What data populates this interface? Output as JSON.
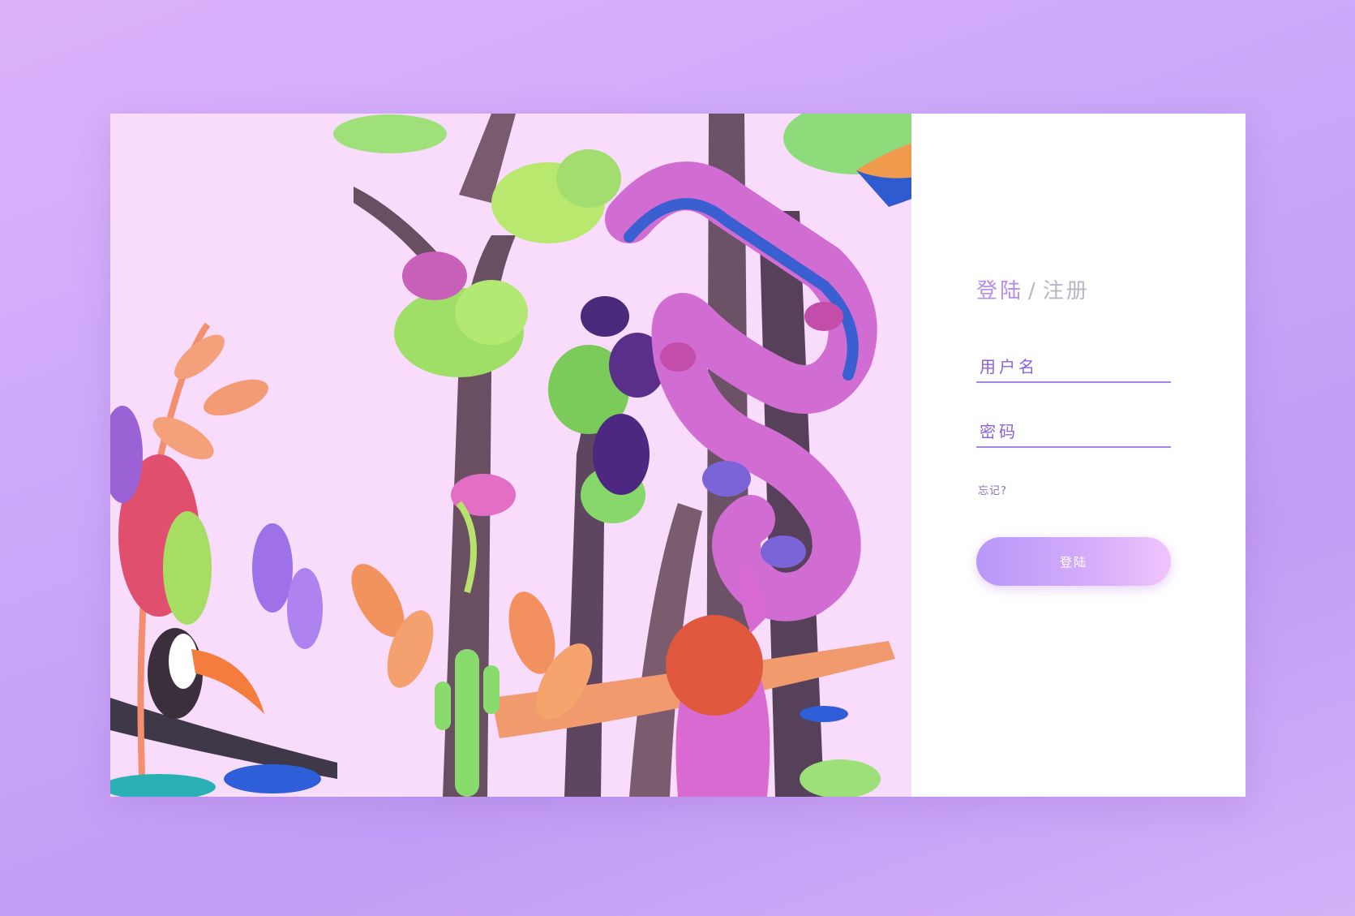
{
  "auth": {
    "login_tab": "登陆",
    "separator": "/",
    "register_tab": "注册",
    "username_placeholder": "用户名",
    "password_placeholder": "密码",
    "forgot_link": "忘记?",
    "login_button": "登陆"
  },
  "colors": {
    "accent": "#b48bf0",
    "field_underline": "#a783ee",
    "button_gradient_start": "#b897f8",
    "button_gradient_end": "#f0c4fb",
    "page_background": "#c9a6f9"
  }
}
